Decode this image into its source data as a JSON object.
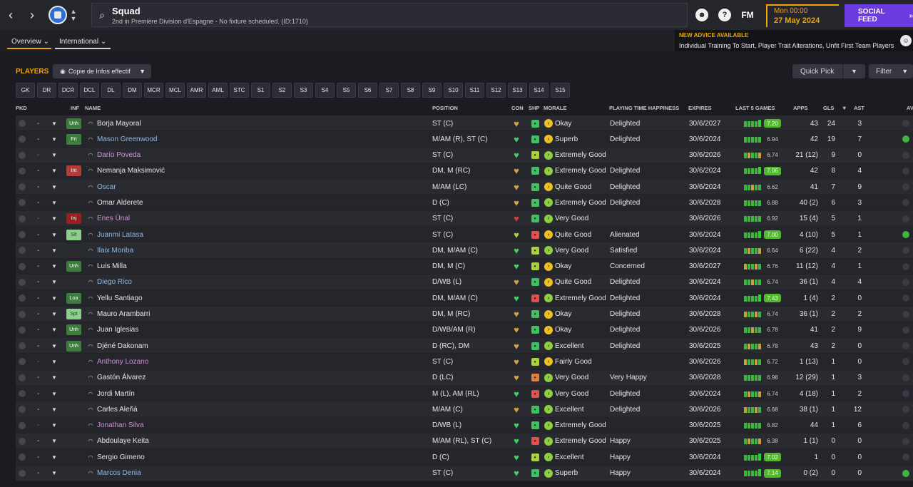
{
  "topbar": {
    "back": "‹",
    "forward": "›",
    "page_title": "Squad",
    "page_subtitle": "2nd in Première Division d'Espagne - No fixture scheduled. (ID:1710)",
    "fm_label": "FM",
    "help_label": "?",
    "date_time": "Mon 00:00",
    "date_day": "27 May 2024",
    "social_feed": "SOCIAL FEED"
  },
  "view_tabs": [
    "Overview",
    "International"
  ],
  "advice": {
    "title": "NEW ADVICE AVAILABLE",
    "body": "Individual Training To Start, Player Trait Alterations, Unfit First Team Players"
  },
  "players_label": "PLAYERS",
  "view_select": "Copie de Infos effectif",
  "quick_pick": "Quick Pick",
  "filter": "Filter",
  "position_buttons": [
    "GK",
    "DR",
    "DCR",
    "DCL",
    "DL",
    "DM",
    "MCR",
    "MCL",
    "AMR",
    "AML",
    "STC",
    "S1",
    "S2",
    "S3",
    "S4",
    "S5",
    "S6",
    "S7",
    "S8",
    "S9",
    "S10",
    "S11",
    "S12",
    "S13",
    "S14",
    "S15"
  ],
  "columns": {
    "pkd": "PKD",
    "inf": "INF",
    "name": "NAME",
    "position": "POSITION",
    "con": "CON",
    "shp": "SHP",
    "morale": "MORALE",
    "happiness": "PLAYING TIME HAPPINESS",
    "expires": "EXPIRES",
    "last5": "LAST 5 GAMES",
    "apps": "APPS",
    "gls": "GLS",
    "ast": "AST",
    "av": "AV"
  },
  "players": [
    {
      "inf": "Unh",
      "inf_color": "green",
      "name": "Borja Mayoral",
      "name_color": "white",
      "position": "ST (C)",
      "morale": "Okay",
      "morale_color": "#f0c020",
      "happiness": "Delighted",
      "expires": "30/6/2027",
      "rating": "7.20",
      "rating_hi": true,
      "apps": "43",
      "gls": "24",
      "ast": "3",
      "dash_red": false,
      "con": "#d8a040",
      "shp": "#40c060",
      "av_green": false
    },
    {
      "inf": "Frt",
      "inf_color": "green",
      "name": "Mason Greenwood",
      "name_color": "blue",
      "position": "M/AM (R), ST (C)",
      "morale": "Superb",
      "morale_color": "#f0c020",
      "happiness": "Delighted",
      "expires": "30/6/2024",
      "rating": "6.94",
      "rating_hi": false,
      "apps": "42",
      "gls": "19",
      "ast": "7",
      "dash_red": false,
      "con": "#40d060",
      "shp": "#40c060",
      "av_green": true
    },
    {
      "inf": "",
      "inf_color": "empty",
      "name": "Darío Poveda",
      "name_color": "pink",
      "position": "ST (C)",
      "morale": "Extremely Good",
      "morale_color": "#8fd040",
      "happiness": "",
      "expires": "30/6/2026",
      "rating": "6.74",
      "rating_hi": false,
      "apps": "21 (12)",
      "gls": "9",
      "ast": "0",
      "dash_red": true,
      "con": "#40d060",
      "shp": "#a8d040",
      "av_green": false
    },
    {
      "inf": "Int",
      "inf_color": "red",
      "name": "Nemanja Maksimović",
      "name_color": "white",
      "position": "DM, M (RC)",
      "morale": "Extremely Good",
      "morale_color": "#8fd040",
      "happiness": "Delighted",
      "expires": "30/6/2024",
      "rating": "7.06",
      "rating_hi": true,
      "apps": "42",
      "gls": "8",
      "ast": "4",
      "dash_red": false,
      "con": "#d8a040",
      "shp": "#40c060",
      "av_green": false
    },
    {
      "inf": "",
      "inf_color": "empty",
      "name": "Oscar",
      "name_color": "blue",
      "position": "M/AM (LC)",
      "morale": "Quite Good",
      "morale_color": "#f0c020",
      "happiness": "Delighted",
      "expires": "30/6/2024",
      "rating": "6.62",
      "rating_hi": false,
      "apps": "41",
      "gls": "7",
      "ast": "9",
      "dash_red": false,
      "con": "#d8a040",
      "shp": "#40c060",
      "av_green": false
    },
    {
      "inf": "",
      "inf_color": "empty",
      "name": "Omar Alderete",
      "name_color": "white",
      "position": "D (C)",
      "morale": "Extremely Good",
      "morale_color": "#8fd040",
      "happiness": "Delighted",
      "expires": "30/6/2028",
      "rating": "6.88",
      "rating_hi": false,
      "apps": "40 (2)",
      "gls": "6",
      "ast": "3",
      "dash_red": false,
      "con": "#d8a040",
      "shp": "#40c060",
      "av_green": false
    },
    {
      "inf": "Inj",
      "inf_color": "dred",
      "name": "Enes Ünal",
      "name_color": "pink",
      "position": "ST (C)",
      "morale": "Very Good",
      "morale_color": "#8fd040",
      "happiness": "",
      "expires": "30/6/2026",
      "rating": "6.92",
      "rating_hi": false,
      "apps": "15 (4)",
      "gls": "5",
      "ast": "1",
      "dash_red": true,
      "con": "#d04040",
      "shp": "#40c060",
      "av_green": false
    },
    {
      "inf": "Slt",
      "inf_color": "lgreen",
      "name": "Juanmi Latasa",
      "name_color": "blue",
      "position": "ST (C)",
      "morale": "Quite Good",
      "morale_color": "#f0c020",
      "happiness": "Alienated",
      "expires": "30/6/2024",
      "rating": "7.00",
      "rating_hi": true,
      "apps": "4 (10)",
      "gls": "5",
      "ast": "1",
      "dash_red": false,
      "con": "#a8d040",
      "shp": "#e05050",
      "av_green": true
    },
    {
      "inf": "",
      "inf_color": "empty",
      "name": "Ilaix Moriba",
      "name_color": "blue",
      "position": "DM, M/AM (C)",
      "morale": "Very Good",
      "morale_color": "#8fd040",
      "happiness": "Satisfied",
      "expires": "30/6/2024",
      "rating": "6.64",
      "rating_hi": false,
      "apps": "6 (22)",
      "gls": "4",
      "ast": "2",
      "dash_red": false,
      "con": "#40d060",
      "shp": "#a8d040",
      "av_green": false
    },
    {
      "inf": "Unh",
      "inf_color": "green",
      "name": "Luis Milla",
      "name_color": "white",
      "position": "DM, M (C)",
      "morale": "Okay",
      "morale_color": "#f0c020",
      "happiness": "Concerned",
      "expires": "30/6/2027",
      "rating": "6.76",
      "rating_hi": false,
      "apps": "11 (12)",
      "gls": "4",
      "ast": "1",
      "dash_red": false,
      "con": "#40d060",
      "shp": "#a8d040",
      "av_green": false
    },
    {
      "inf": "",
      "inf_color": "empty",
      "name": "Diego Rico",
      "name_color": "blue",
      "position": "D/WB (L)",
      "morale": "Quite Good",
      "morale_color": "#f0c020",
      "happiness": "Delighted",
      "expires": "30/6/2024",
      "rating": "6.74",
      "rating_hi": false,
      "apps": "36 (1)",
      "gls": "4",
      "ast": "4",
      "dash_red": false,
      "con": "#d8a040",
      "shp": "#40c060",
      "av_green": false
    },
    {
      "inf": "Loa",
      "inf_color": "green",
      "name": "Yellu Santiago",
      "name_color": "white",
      "position": "DM, M/AM (C)",
      "morale": "Extremely Good",
      "morale_color": "#8fd040",
      "happiness": "Delighted",
      "expires": "30/6/2024",
      "rating": "7.43",
      "rating_hi": true,
      "apps": "1 (4)",
      "gls": "2",
      "ast": "0",
      "dash_red": false,
      "con": "#40d060",
      "shp": "#e05050",
      "av_green": false
    },
    {
      "inf": "Spt",
      "inf_color": "lgreen",
      "name": "Mauro Arambarri",
      "name_color": "white",
      "position": "DM, M (RC)",
      "morale": "Okay",
      "morale_color": "#f0c020",
      "happiness": "Delighted",
      "expires": "30/6/2028",
      "rating": "6.74",
      "rating_hi": false,
      "apps": "36 (1)",
      "gls": "2",
      "ast": "2",
      "dash_red": false,
      "con": "#d8a040",
      "shp": "#40c060",
      "av_green": false
    },
    {
      "inf": "Unh",
      "inf_color": "green",
      "name": "Juan Iglesias",
      "name_color": "white",
      "position": "D/WB/AM (R)",
      "morale": "Okay",
      "morale_color": "#f0c020",
      "happiness": "Delighted",
      "expires": "30/6/2026",
      "rating": "6.78",
      "rating_hi": false,
      "apps": "41",
      "gls": "2",
      "ast": "9",
      "dash_red": false,
      "con": "#d8a040",
      "shp": "#40c060",
      "av_green": false
    },
    {
      "inf": "Unh",
      "inf_color": "green",
      "name": "Djéné Dakonam",
      "name_color": "white",
      "position": "D (RC), DM",
      "morale": "Excellent",
      "morale_color": "#8fd040",
      "happiness": "Delighted",
      "expires": "30/6/2025",
      "rating": "6.78",
      "rating_hi": false,
      "apps": "43",
      "gls": "2",
      "ast": "0",
      "dash_red": false,
      "con": "#d8a040",
      "shp": "#40c060",
      "av_green": false
    },
    {
      "inf": "",
      "inf_color": "empty",
      "name": "Anthony Lozano",
      "name_color": "pink",
      "position": "ST (C)",
      "morale": "Fairly Good",
      "morale_color": "#f0c020",
      "happiness": "",
      "expires": "30/6/2026",
      "rating": "6.72",
      "rating_hi": false,
      "apps": "1 (13)",
      "gls": "1",
      "ast": "0",
      "dash_red": true,
      "con": "#d8a040",
      "shp": "#a8d040",
      "av_green": false
    },
    {
      "inf": "",
      "inf_color": "empty",
      "name": "Gastón Álvarez",
      "name_color": "white",
      "position": "D (LC)",
      "morale": "Very Good",
      "morale_color": "#8fd040",
      "happiness": "Very Happy",
      "expires": "30/6/2028",
      "rating": "6.98",
      "rating_hi": false,
      "apps": "12 (29)",
      "gls": "1",
      "ast": "3",
      "dash_red": false,
      "con": "#d8a040",
      "shp": "#e08040",
      "av_green": false
    },
    {
      "inf": "",
      "inf_color": "empty",
      "name": "Jordi Martín",
      "name_color": "white",
      "position": "M (L), AM (RL)",
      "morale": "Very Good",
      "morale_color": "#8fd040",
      "happiness": "Delighted",
      "expires": "30/6/2024",
      "rating": "6.74",
      "rating_hi": false,
      "apps": "4 (18)",
      "gls": "1",
      "ast": "2",
      "dash_red": false,
      "con": "#40d060",
      "shp": "#e05050",
      "av_green": false
    },
    {
      "inf": "",
      "inf_color": "empty",
      "name": "Carles Aleñá",
      "name_color": "white",
      "position": "M/AM (C)",
      "morale": "Excellent",
      "morale_color": "#8fd040",
      "happiness": "Delighted",
      "expires": "30/6/2026",
      "rating": "6.68",
      "rating_hi": false,
      "apps": "38 (1)",
      "gls": "1",
      "ast": "12",
      "dash_red": false,
      "con": "#d8a040",
      "shp": "#40c060",
      "av_green": false
    },
    {
      "inf": "",
      "inf_color": "empty",
      "name": "Jonathan Silva",
      "name_color": "pink",
      "position": "D/WB (L)",
      "morale": "Extremely Good",
      "morale_color": "#8fd040",
      "happiness": "",
      "expires": "30/6/2025",
      "rating": "6.82",
      "rating_hi": false,
      "apps": "44",
      "gls": "1",
      "ast": "6",
      "dash_red": true,
      "con": "#40d060",
      "shp": "#40c060",
      "av_green": false
    },
    {
      "inf": "",
      "inf_color": "empty",
      "name": "Abdoulaye Keita",
      "name_color": "white",
      "position": "M/AM (RL), ST (C)",
      "morale": "Extremely Good",
      "morale_color": "#8fd040",
      "happiness": "Happy",
      "expires": "30/6/2025",
      "rating": "6.38",
      "rating_hi": false,
      "apps": "1 (1)",
      "gls": "0",
      "ast": "0",
      "dash_red": false,
      "con": "#40d060",
      "shp": "#e05050",
      "av_green": false
    },
    {
      "inf": "",
      "inf_color": "empty",
      "name": "Sergio Gimeno",
      "name_color": "white",
      "position": "D (C)",
      "morale": "Excellent",
      "morale_color": "#8fd040",
      "happiness": "Happy",
      "expires": "30/6/2024",
      "rating": "7.02",
      "rating_hi": true,
      "apps": "1",
      "gls": "0",
      "ast": "0",
      "dash_red": false,
      "con": "#40d060",
      "shp": "#a8d040",
      "av_green": false
    },
    {
      "inf": "",
      "inf_color": "empty",
      "name": "Marcos Denia",
      "name_color": "blue",
      "position": "ST (C)",
      "morale": "Superb",
      "morale_color": "#8fd040",
      "happiness": "Happy",
      "expires": "30/6/2024",
      "rating": "7.14",
      "rating_hi": true,
      "apps": "0 (2)",
      "gls": "0",
      "ast": "0",
      "dash_red": false,
      "con": "#40d060",
      "shp": "#40c060",
      "av_green": true
    }
  ]
}
